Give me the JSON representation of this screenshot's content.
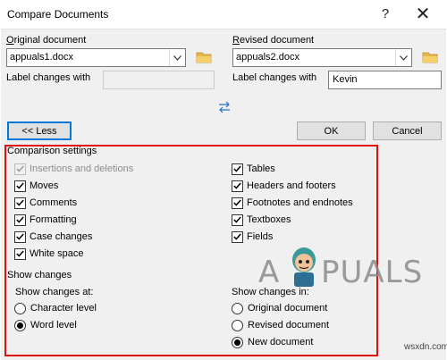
{
  "window": {
    "title": "Compare Documents",
    "help_label": "?",
    "close_label": "✕"
  },
  "original": {
    "heading": "Original document",
    "file": "appuals1.docx",
    "label_changes_with": "Label changes with",
    "label_value": ""
  },
  "revised": {
    "heading": "Revised document",
    "file": "appuals2.docx",
    "label_changes_with": "Label changes with",
    "label_value": "Kevin"
  },
  "buttons": {
    "less": "<< Less",
    "ok": "OK",
    "cancel": "Cancel"
  },
  "comparison_settings": {
    "heading": "Comparison settings",
    "left": [
      {
        "label": "Insertions and deletions",
        "checked": true,
        "disabled": true
      },
      {
        "label": "Moves",
        "checked": true,
        "disabled": false
      },
      {
        "label": "Comments",
        "checked": true,
        "disabled": false
      },
      {
        "label": "Formatting",
        "checked": true,
        "disabled": false
      },
      {
        "label": "Case changes",
        "checked": true,
        "disabled": false
      },
      {
        "label": "White space",
        "checked": true,
        "disabled": false
      }
    ],
    "right": [
      {
        "label": "Tables",
        "checked": true,
        "disabled": false
      },
      {
        "label": "Headers and footers",
        "checked": true,
        "disabled": false
      },
      {
        "label": "Footnotes and endnotes",
        "checked": true,
        "disabled": false
      },
      {
        "label": "Textboxes",
        "checked": true,
        "disabled": false
      },
      {
        "label": "Fields",
        "checked": true,
        "disabled": false
      }
    ]
  },
  "show_changes": {
    "heading": "Show changes",
    "at_label": "Show changes at:",
    "at_options": [
      {
        "label": "Character level",
        "selected": false
      },
      {
        "label": "Word level",
        "selected": true
      }
    ],
    "in_label": "Show changes in:",
    "in_options": [
      {
        "label": "Original document",
        "selected": false
      },
      {
        "label": "Revised document",
        "selected": false
      },
      {
        "label": "New document",
        "selected": true
      }
    ]
  },
  "watermark": {
    "left": "A",
    "right": "PUALS",
    "source": "wsxdn.com"
  },
  "colors": {
    "highlight_box": "#e01010",
    "default_button_border": "#0078d7",
    "dialog_bg": "#f0f0f0"
  }
}
